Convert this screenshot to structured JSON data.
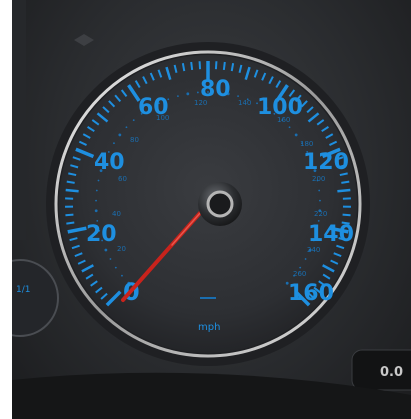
{
  "speedometer": {
    "unit_label": "mph",
    "needle_value_mph": 0,
    "mph_labels": [
      "0",
      "20",
      "40",
      "60",
      "80",
      "100",
      "120",
      "140",
      "160"
    ],
    "kmh_labels": [
      "20",
      "40",
      "60",
      "80",
      "100",
      "120",
      "140",
      "160",
      "180",
      "200",
      "220",
      "240",
      "260"
    ]
  },
  "odometer": {
    "reading": "0.0"
  },
  "colors": {
    "dial_blue": "#1e8fe0",
    "kmh_blue": "#1a6eb0",
    "needle_red": "#c8231c",
    "chrome": "#d7d7d7"
  }
}
